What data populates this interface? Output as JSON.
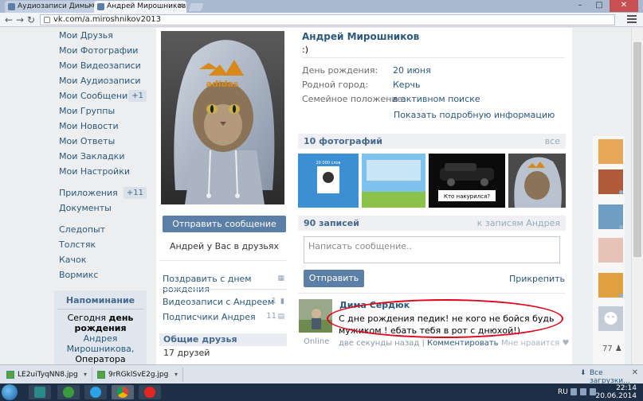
{
  "browser": {
    "tabs": [
      {
        "title": "Аудиозаписи Димы С",
        "active": false
      },
      {
        "title": "Андрей Мирошников",
        "active": true
      }
    ],
    "url": "vk.com/a.miroshnikov2013",
    "window_controls": [
      "–",
      "□",
      "✕"
    ]
  },
  "left_menu": {
    "items": [
      {
        "label": "Мои Друзья",
        "count": ""
      },
      {
        "label": "Мои Фотографии",
        "count": ""
      },
      {
        "label": "Мои Видеозаписи",
        "count": ""
      },
      {
        "label": "Мои Аудиозаписи",
        "count": ""
      },
      {
        "label": "Мои Сообщения",
        "count": "+1"
      },
      {
        "label": "Мои Группы",
        "count": ""
      },
      {
        "label": "Мои Новости",
        "count": ""
      },
      {
        "label": "Мои Ответы",
        "count": ""
      },
      {
        "label": "Мои Закладки",
        "count": ""
      },
      {
        "label": "Мои Настройки",
        "count": ""
      }
    ],
    "apps": [
      {
        "label": "Приложения",
        "count": "+11"
      },
      {
        "label": "Документы",
        "count": ""
      }
    ],
    "extra": [
      {
        "label": "Следопыт"
      },
      {
        "label": "Толстяк"
      },
      {
        "label": "Качок"
      },
      {
        "label": "Вормикс"
      }
    ],
    "reminder": {
      "title": "Напоминание",
      "line1": "Сегодня",
      "line1b": "день",
      "line2": "рождения",
      "link": "Андрея Мирошникова,",
      "line3": "Оператора Императора."
    }
  },
  "profile": {
    "name": "Андрей Мирошников",
    "status": ":)",
    "info": [
      {
        "label": "День рождения:",
        "value": "20 июня"
      },
      {
        "label": "Родной город:",
        "value": "Керчь"
      },
      {
        "label": "Семейное положение:",
        "value": "в активном поиске"
      }
    ],
    "more_info": "Показать подробную информацию",
    "send_message": "Отправить сообщение",
    "friend_note": "Андрей у Вас в друзьях",
    "congratulate": "Поздравить с днем рождения",
    "videos_with": "Видеозаписи с Андреем",
    "videos_with_count": "1",
    "subscribers": "Подписчики Андрея",
    "subscribers_count": "11",
    "common_friends": "Общие друзья",
    "common_friends_count": "17 друзей"
  },
  "photos": {
    "header": "10 фотографий",
    "all": "все",
    "thumb_texts": [
      "20 000 слов",
      "Кто накурился?"
    ]
  },
  "wall": {
    "header": "90 записей",
    "to_posts": "к записям Андрея",
    "placeholder": "Написать сообщение..",
    "send": "Отправить",
    "attach": "Прикрепить",
    "post": {
      "author": "Дима Сердюк",
      "text": "С дне рождения педик! не кого не бойся будь мужиком ! ебать тебя в рот с днюхой!)",
      "online": "Online",
      "time": "две секунды назад",
      "comment": "Комментировать",
      "like": "Мне нравится"
    }
  },
  "right_strip": {
    "count": "77"
  },
  "downloads": {
    "files": [
      "LE2uiTyqNN8.jpg",
      "9rRGklSvE2g.jpg"
    ],
    "all": "Все загрузки..."
  },
  "taskbar": {
    "lang": "RU",
    "time": "22:14",
    "date": "20.06.2014"
  },
  "colors": {
    "vk_blue": "#5b7fa6",
    "link": "#2b587a",
    "highlight_ellipse": "#e0001a"
  }
}
